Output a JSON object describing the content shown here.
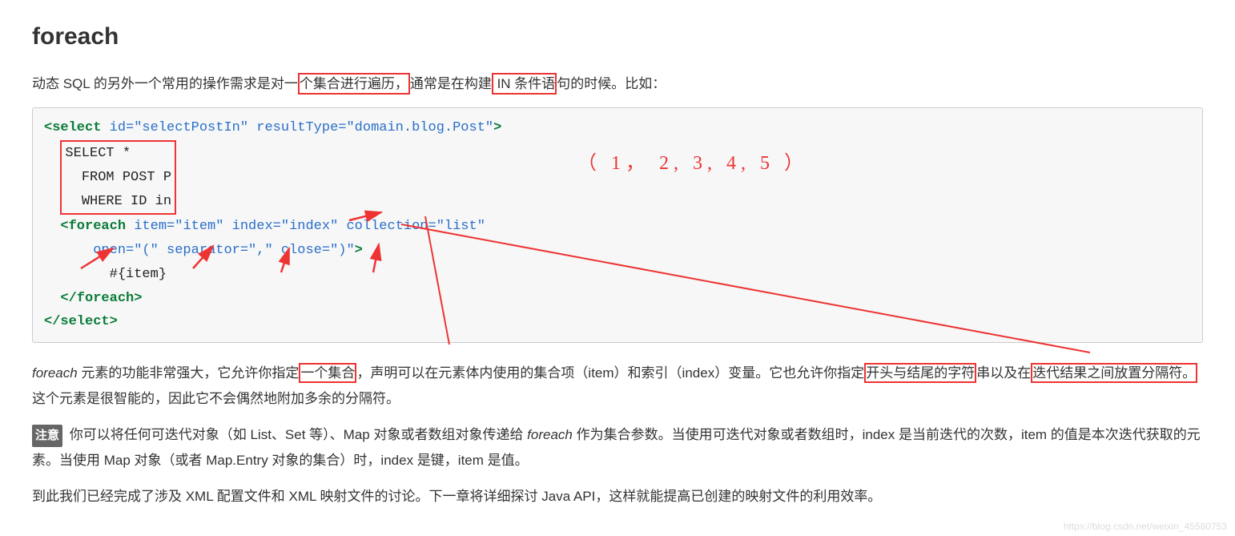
{
  "heading": "foreach",
  "intro": {
    "pre1": "动态 SQL 的另外一个常用的操作需求是对一",
    "box1": "个集合进行遍历，",
    "mid": "通常是在构建",
    "box2": " IN 条件语",
    "post": "句的时候。比如："
  },
  "code": {
    "l1_open": "<select",
    "l1_attrs": " id=\"selectPostIn\" resultType=\"domain.blog.Post\"",
    "l1_close": ">",
    "sql1": "SELECT *",
    "sql2": "FROM POST P",
    "sql3": "WHERE ID in",
    "fe_open": "<foreach",
    "fe_attrs1": " item=\"item\" index=\"index\" collection=\"list\"",
    "fe_attrs2": "open=\"(\" separator=\",\" close=\")\"",
    "fe_close": ">",
    "fe_body": "#{item}",
    "fe_end": "</foreach>",
    "sel_end": "</select>"
  },
  "annot": "（ 1， 2, 3, 4, 5 ）",
  "para2": {
    "p1": "foreach",
    "p2": " 元素的功能非常强大，它允许你指定",
    "box1": "一个集合",
    "p3": "，声明可以在元素体内使用的集合项（item）和索引（index）变量。它也允许你指定",
    "box2": "开头与结尾的字符",
    "p3b": "串以及在",
    "box3": "迭代结果之间放置分隔符。",
    "p4": "这个元素是很智能的，因此它不会偶然地附加多余的分隔符。"
  },
  "note_label": "注意",
  "para3a": " 你可以将任何可迭代对象（如 List、Set 等）、Map 对象或者数组对象传递给 ",
  "para3i": "foreach",
  "para3b": " 作为集合参数。当使用可迭代对象或者数组时，index 是当前迭代的次数，item 的值是本次迭代获取的元素。当使用 Map 对象（或者 Map.Entry 对象的集合）时，index 是键，item 是值。",
  "para4": "到此我们已经完成了涉及 XML 配置文件和 XML 映射文件的讨论。下一章将详细探讨 Java API，这样就能提高已创建的映射文件的利用效率。",
  "watermark": "https://blog.csdn.net/weixin_45580753"
}
